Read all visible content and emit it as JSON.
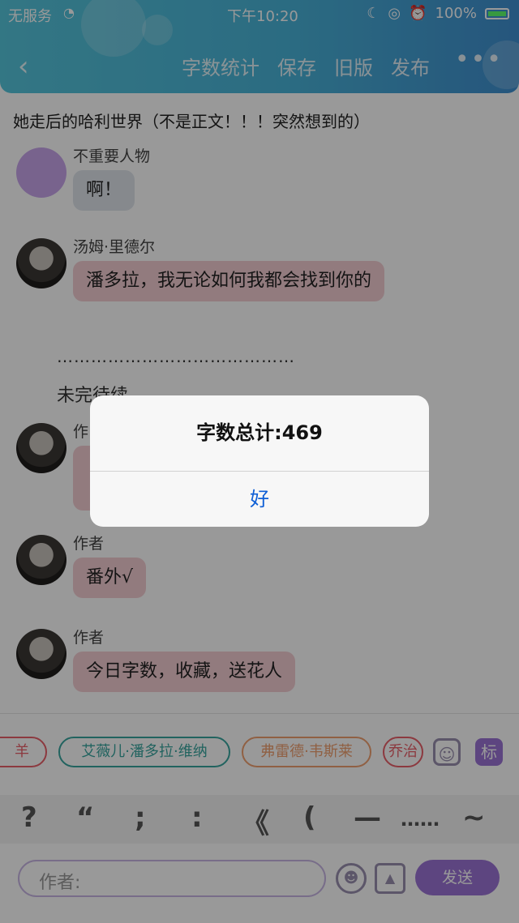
{
  "status_bar": {
    "carrier": "无服务",
    "time": "下午10:20",
    "battery": "100%"
  },
  "nav": {
    "items": [
      "字数统计",
      "保存",
      "旧版",
      "发布"
    ]
  },
  "doc_title": "她走后的哈利世界（不是正文！！！突然想到的）",
  "messages": [
    {
      "sender": "不重要人物",
      "text": "啊！"
    },
    {
      "sender": "汤姆·里德尔",
      "text": "潘多拉，我无论如何我都会找到你的"
    },
    {
      "sender": "作",
      "text": ""
    },
    {
      "sender": "作者",
      "text": "番外√"
    },
    {
      "sender": "作者",
      "text": "今日字数，收藏，送花人"
    }
  ],
  "dotted_line": "……………………………………",
  "to_be_continued": "未完待续",
  "tags": [
    "羊",
    "艾薇儿·潘多拉·维纳",
    "弗雷德·韦斯莱",
    "乔治"
  ],
  "tag_button": "标",
  "punctuation": [
    "?",
    "“",
    ";",
    ":",
    "《",
    "(",
    "—",
    "……",
    "~"
  ],
  "input": {
    "placeholder": "作者:"
  },
  "send_label": "发送",
  "alert": {
    "title": "字数总计:469",
    "ok_label": "好"
  },
  "colors": {
    "header_gradient_start": "#56c6dc",
    "header_gradient_end": "#3f8fd0",
    "accent_purple": "#9c74d6",
    "alert_button_blue": "#0e5fd6"
  }
}
